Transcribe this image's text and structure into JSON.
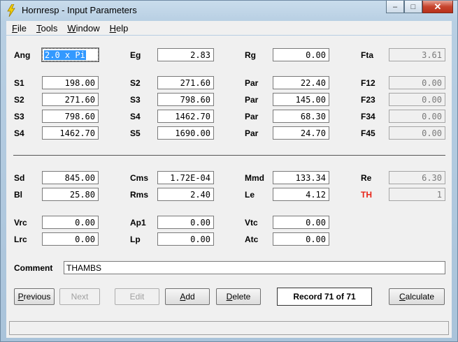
{
  "window": {
    "title": "Hornresp - Input Parameters",
    "minimize_glyph": "–",
    "maximize_glyph": "□",
    "close_glyph": "✕"
  },
  "menu": [
    "File",
    "Tools",
    "Window",
    "Help"
  ],
  "row_ang": {
    "ang_label": "Ang",
    "ang_value": "2.0 x Pi",
    "eg_label": "Eg",
    "eg_value": "2.83",
    "rg_label": "Rg",
    "rg_value": "0.00",
    "fta_label": "Fta",
    "fta_value": "3.61"
  },
  "horn_rows": [
    {
      "a_label": "S1",
      "a_value": "198.00",
      "b_label": "S2",
      "b_value": "271.60",
      "c_label": "Par",
      "c_value": "22.40",
      "d_label": "F12",
      "d_value": "0.00"
    },
    {
      "a_label": "S2",
      "a_value": "271.60",
      "b_label": "S3",
      "b_value": "798.60",
      "c_label": "Par",
      "c_value": "145.00",
      "d_label": "F23",
      "d_value": "0.00"
    },
    {
      "a_label": "S3",
      "a_value": "798.60",
      "b_label": "S4",
      "b_value": "1462.70",
      "c_label": "Par",
      "c_value": "68.30",
      "d_label": "F34",
      "d_value": "0.00"
    },
    {
      "a_label": "S4",
      "a_value": "1462.70",
      "b_label": "S5",
      "b_value": "1690.00",
      "c_label": "Par",
      "c_value": "24.70",
      "d_label": "F45",
      "d_value": "0.00"
    }
  ],
  "driver_rows": [
    {
      "a_label": "Sd",
      "a_value": "845.00",
      "b_label": "Cms",
      "b_value": "1.72E-04",
      "c_label": "Mmd",
      "c_value": "133.34",
      "d_label": "Re",
      "d_value": "6.30"
    },
    {
      "a_label": "Bl",
      "a_value": "25.80",
      "b_label": "Rms",
      "b_value": "2.40",
      "c_label": "Le",
      "c_value": "4.12",
      "d_label": "TH",
      "d_value": "1"
    }
  ],
  "chamber_rows": [
    {
      "a_label": "Vrc",
      "a_value": "0.00",
      "b_label": "Ap1",
      "b_value": "0.00",
      "c_label": "Vtc",
      "c_value": "0.00"
    },
    {
      "a_label": "Lrc",
      "a_value": "0.00",
      "b_label": "Lp",
      "b_value": "0.00",
      "c_label": "Atc",
      "c_value": "0.00"
    }
  ],
  "comment": {
    "label": "Comment",
    "value": "THAMBS"
  },
  "buttons": {
    "previous": "Previous",
    "next": "Next",
    "edit": "Edit",
    "add": "Add",
    "delete": "Delete",
    "calculate": "Calculate"
  },
  "record_text": "Record 71 of 71",
  "colors": {
    "th_label": "#e8261a",
    "selection": "#3399ff"
  }
}
